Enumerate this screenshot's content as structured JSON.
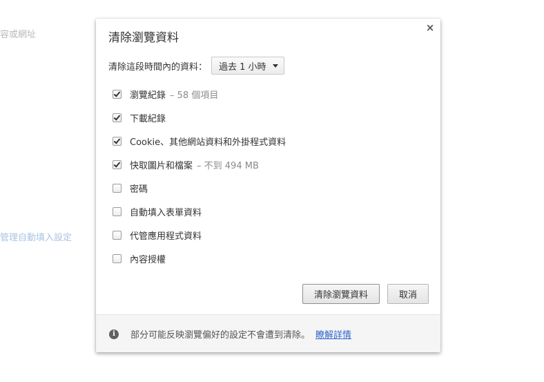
{
  "background": {
    "text1": "容或網址",
    "text2": "管理自動填入設定"
  },
  "dialog": {
    "title": "清除瀏覽資料",
    "close_symbol": "×",
    "period_label": "清除這段時間內的資料：",
    "period_value": "過去 1 小時",
    "items": [
      {
        "label": "瀏覽紀錄",
        "sub": "– 58 個項目",
        "checked": true
      },
      {
        "label": "下載紀錄",
        "sub": "",
        "checked": true
      },
      {
        "label": "Cookie、其他網站資料和外掛程式資料",
        "sub": "",
        "checked": true
      },
      {
        "label": "快取圖片和檔案",
        "sub": "– 不到 494 MB",
        "checked": true
      },
      {
        "label": "密碼",
        "sub": "",
        "checked": false
      },
      {
        "label": "自動填入表單資料",
        "sub": "",
        "checked": false
      },
      {
        "label": "代管應用程式資料",
        "sub": "",
        "checked": false
      },
      {
        "label": "內容授權",
        "sub": "",
        "checked": false
      }
    ],
    "clear_button": "清除瀏覽資料",
    "cancel_button": "取消",
    "footer_text": "部分可能反映瀏覽偏好的設定不會遭到清除。",
    "footer_link": "瞭解詳情",
    "info_symbol": "i"
  },
  "colors": {
    "link": "#3366cc",
    "checkmark": "#333333"
  }
}
